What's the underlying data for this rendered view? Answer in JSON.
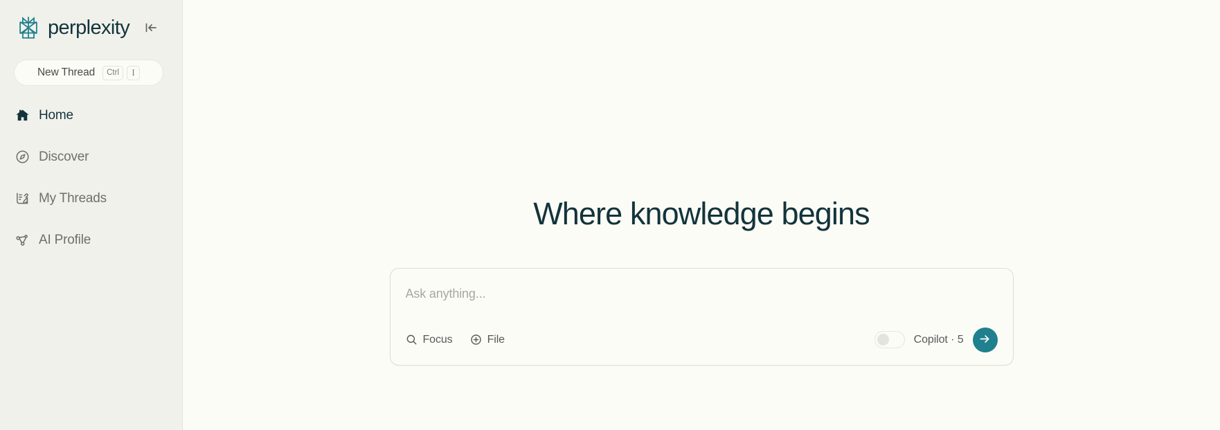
{
  "brand": {
    "name": "perplexity",
    "logo_icon": "perplexity-logo-icon",
    "accent_color": "#20808D",
    "text_color": "#13343B"
  },
  "sidebar": {
    "collapse_icon": "collapse-sidebar-icon",
    "new_thread": {
      "label": "New Thread",
      "shortcut_modifier": "Ctrl",
      "shortcut_key": "I"
    },
    "items": [
      {
        "label": "Home",
        "icon": "home-icon",
        "active": true
      },
      {
        "label": "Discover",
        "icon": "compass-icon",
        "active": false
      },
      {
        "label": "My Threads",
        "icon": "threads-icon",
        "active": false
      },
      {
        "label": "AI Profile",
        "icon": "ai-profile-icon",
        "active": false
      }
    ]
  },
  "main": {
    "title": "Where knowledge begins",
    "ask": {
      "placeholder": "Ask anything...",
      "value": "",
      "tools": [
        {
          "label": "Focus",
          "icon": "search-icon"
        },
        {
          "label": "File",
          "icon": "plus-circle-icon"
        }
      ],
      "copilot": {
        "label": "Copilot · 5",
        "enabled": false
      },
      "submit_icon": "arrow-right-icon"
    }
  }
}
